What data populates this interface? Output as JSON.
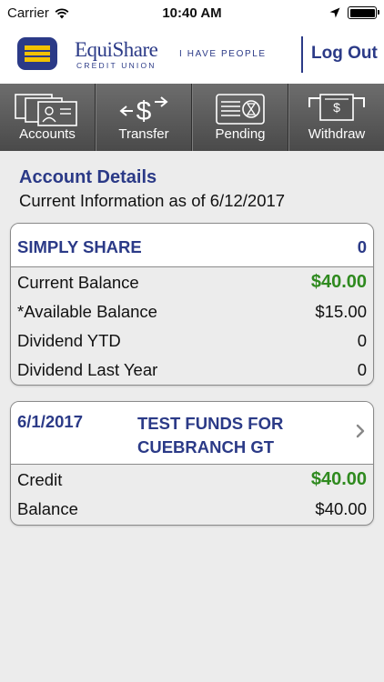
{
  "status_bar": {
    "carrier": "Carrier",
    "time": "10:40 AM"
  },
  "header": {
    "brand_name": "EquiShare",
    "brand_sub": "CREDIT UNION",
    "tagline": "I HAVE PEOPLE",
    "logout_label": "Log Out",
    "brand_color": "#2b3a87",
    "logo_accent_color": "#f2c200"
  },
  "toolbar": {
    "items": [
      {
        "label": "Accounts",
        "icon": "accounts-icon"
      },
      {
        "label": "Transfer",
        "icon": "transfer-icon"
      },
      {
        "label": "Pending",
        "icon": "pending-icon"
      },
      {
        "label": "Withdraw",
        "icon": "withdraw-icon"
      }
    ]
  },
  "account_details": {
    "title": "Account Details",
    "subtitle": "Current Information as of 6/12/2017"
  },
  "account_card": {
    "name": "SIMPLY SHARE",
    "number": "0",
    "rows": [
      {
        "label": "Current Balance",
        "value": "$40.00"
      },
      {
        "label": "*Available Balance",
        "value": "$15.00"
      },
      {
        "label": "Dividend YTD",
        "value": "0"
      },
      {
        "label": "Dividend Last Year",
        "value": "0"
      }
    ]
  },
  "transaction_card": {
    "date": "6/1/2017",
    "description": "TEST FUNDS FOR CUEBRANCH GT",
    "rows": [
      {
        "label": "Credit",
        "value": "$40.00"
      },
      {
        "label": "Balance",
        "value": "$40.00"
      }
    ]
  },
  "colors": {
    "positive_amount": "#2f8a1f",
    "toolbar_bg": "#5a5a5a"
  }
}
